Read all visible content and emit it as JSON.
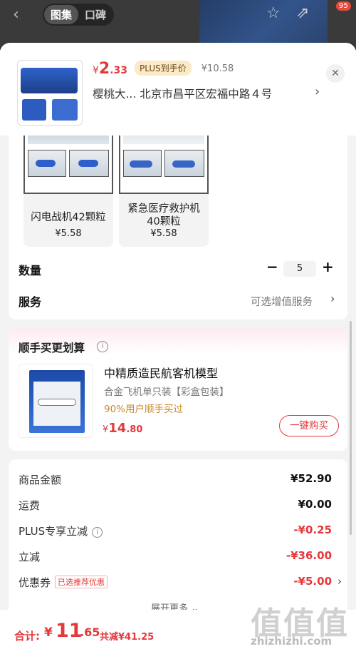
{
  "header": {
    "tabs": [
      "图集",
      "口碑"
    ],
    "notif_count": "95"
  },
  "product": {
    "price_currency": "¥",
    "price_int": "2",
    "price_dec": ".33",
    "plus_tag": "PLUS到手价",
    "original_price": "¥10.58",
    "address": "樱桃大...  北京市昌平区宏福中路４号"
  },
  "variants": [
    {
      "name": "闪电战机42颗粒",
      "price": "¥5.58"
    },
    {
      "name": "紧急医疗救护机40颗粒",
      "price": "¥5.58"
    }
  ],
  "quantity": {
    "label": "数量",
    "value": "5"
  },
  "service": {
    "label": "服务",
    "value": "可选增值服务"
  },
  "buy_together": {
    "title": "顺手买更划算",
    "item_name": "中精质造民航客机模型",
    "item_sub": "合金飞机单只装【彩盒包装】",
    "item_pct": "90%用户顺手买过",
    "price_cur": "¥",
    "price_int": "14",
    "price_dec": ".80",
    "button": "一键购买"
  },
  "breakdown": [
    {
      "label": "商品金额",
      "value": "¥52.90"
    },
    {
      "label": "运费",
      "value": "¥0.00"
    },
    {
      "label": "PLUS专享立减",
      "value": "-¥0.25"
    },
    {
      "label": "立减",
      "value": "-¥36.00"
    },
    {
      "label": "优惠券",
      "tag": "已选推荐优惠",
      "value": "-¥5.00"
    }
  ],
  "expand_label": "展开更多",
  "total": {
    "label": "合计:",
    "cur": "¥",
    "int": "11",
    "dec": ".65",
    "saved": "共减¥41.25"
  },
  "watermark": {
    "text": "值值值",
    "site": "zhizhizhi.com"
  }
}
